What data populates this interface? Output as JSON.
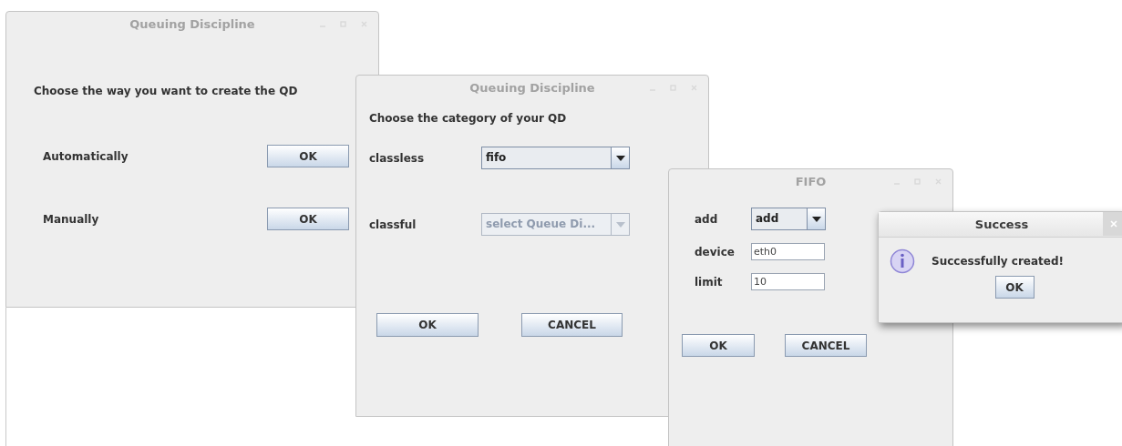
{
  "windows": [
    {
      "kind": "chooser",
      "title": "Queuing Discipline",
      "active": false,
      "prompt": "Choose the way you want to create the QD",
      "rows": [
        {
          "label": "Automatically",
          "button": "OK"
        },
        {
          "label": "Manually",
          "button": "OK"
        }
      ]
    },
    {
      "kind": "category",
      "title": "Queuing Discipline",
      "active": false,
      "prompt": "Choose the category of your QD",
      "rows": [
        {
          "label": "classless",
          "value": "fifo",
          "disabled": false
        },
        {
          "label": "classful",
          "value": "select Queue Di...",
          "disabled": true
        }
      ],
      "buttons": [
        "OK",
        "CANCEL"
      ]
    },
    {
      "kind": "form",
      "title": "FIFO",
      "active": false,
      "rows": [
        {
          "label": "add",
          "kind": "dropdown",
          "value": "add"
        },
        {
          "label": "device",
          "kind": "text",
          "value": "eth0"
        },
        {
          "label": "limit",
          "kind": "text",
          "value": "10"
        }
      ],
      "buttons": [
        "OK",
        "CANCEL"
      ]
    },
    {
      "kind": "message",
      "title": "Success",
      "active": true,
      "message": "Successfully created!",
      "button": "OK"
    }
  ]
}
